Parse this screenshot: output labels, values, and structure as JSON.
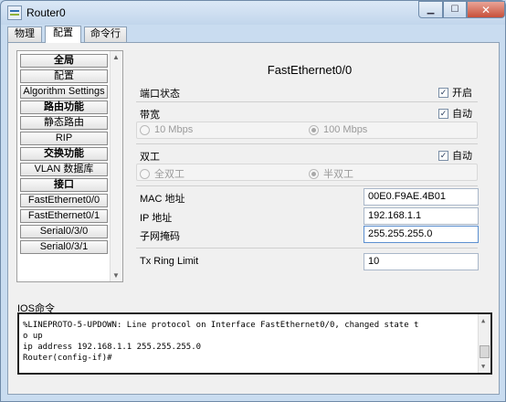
{
  "window": {
    "title": "Router0"
  },
  "tabs": [
    {
      "label": "物理"
    },
    {
      "label": "配置"
    },
    {
      "label": "命令行"
    }
  ],
  "nav": {
    "items": [
      {
        "label": "全局",
        "header": true
      },
      {
        "label": "配置",
        "header": false
      },
      {
        "label": "Algorithm Settings",
        "header": false
      },
      {
        "label": "路由功能",
        "header": true
      },
      {
        "label": "静态路由",
        "header": false
      },
      {
        "label": "RIP",
        "header": false
      },
      {
        "label": "交换功能",
        "header": true
      },
      {
        "label": "VLAN 数据库",
        "header": false
      },
      {
        "label": "接口",
        "header": true
      },
      {
        "label": "FastEthernet0/0",
        "header": false
      },
      {
        "label": "FastEthernet0/1",
        "header": false
      },
      {
        "label": "Serial0/3/0",
        "header": false
      },
      {
        "label": "Serial0/3/1",
        "header": false
      }
    ]
  },
  "panel": {
    "title": "FastEthernet0/0",
    "port_status": {
      "label": "端口状态",
      "checkbox_label": "开启",
      "checked": true
    },
    "bandwidth": {
      "label": "带宽",
      "auto_label": "自动",
      "auto_checked": true,
      "options": [
        "10 Mbps",
        "100 Mbps"
      ],
      "selected": "100 Mbps"
    },
    "duplex": {
      "label": "双工",
      "auto_label": "自动",
      "auto_checked": true,
      "options": [
        "全双工",
        "半双工"
      ],
      "selected": "半双工"
    },
    "mac": {
      "label": "MAC 地址",
      "value": "00E0.F9AE.4B01"
    },
    "ip": {
      "label": "IP 地址",
      "value": "192.168.1.1"
    },
    "mask": {
      "label": "子网掩码",
      "value": "255.255.255.0"
    },
    "tx_ring": {
      "label": "Tx Ring Limit",
      "value": "10"
    }
  },
  "ios": {
    "label": "IOS命令",
    "lines": [
      "%LINEPROTO-5-UPDOWN: Line protocol on Interface FastEthernet0/0, changed state t",
      "o up",
      "ip address 192.168.1.1 255.255.255.0",
      "Router(config-if)#"
    ]
  },
  "check_mark": "✓"
}
